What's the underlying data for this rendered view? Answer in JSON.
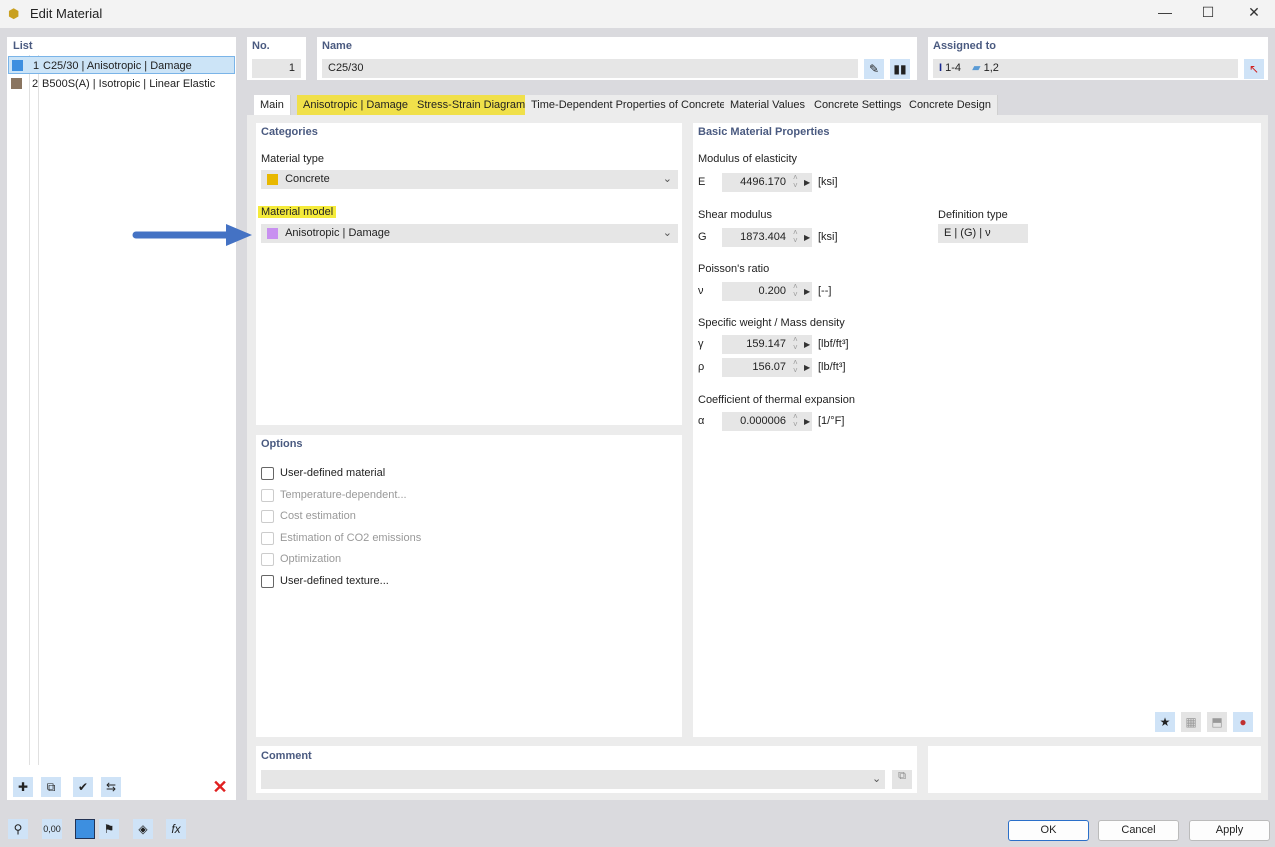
{
  "window": {
    "title": "Edit Material"
  },
  "list": {
    "header": "List",
    "items": [
      {
        "no": "1",
        "label": "C25/30 | Anisotropic | Damage",
        "color": "#3d8fe0",
        "selected": true
      },
      {
        "no": "2",
        "label": "B500S(A) | Isotropic | Linear Elastic",
        "color": "#8a7560",
        "selected": false
      }
    ]
  },
  "no": {
    "label": "No.",
    "value": "1"
  },
  "name": {
    "label": "Name",
    "value": "C25/30"
  },
  "assigned": {
    "label": "Assigned to",
    "members": "1-4",
    "surfaces": "1,2"
  },
  "tabs": [
    {
      "label": "Main"
    },
    {
      "label": "Anisotropic | Damage"
    },
    {
      "label": "Stress-Strain Diagram"
    },
    {
      "label": "Time-Dependent Properties of Concrete"
    },
    {
      "label": "Material Values"
    },
    {
      "label": "Concrete Settings"
    },
    {
      "label": "Concrete Design"
    }
  ],
  "categories": {
    "header": "Categories",
    "material_type_label": "Material type",
    "material_type": "Concrete",
    "material_type_color": "#e8b800",
    "material_model_label": "Material model",
    "material_model": "Anisotropic | Damage",
    "material_model_color": "#c890f0"
  },
  "options": {
    "header": "Options",
    "items": [
      {
        "label": "User-defined material",
        "enabled": true
      },
      {
        "label": "Temperature-dependent...",
        "enabled": false
      },
      {
        "label": "Cost estimation",
        "enabled": false
      },
      {
        "label": "Estimation of CO2 emissions",
        "enabled": false
      },
      {
        "label": "Optimization",
        "enabled": false
      },
      {
        "label": "User-defined texture...",
        "enabled": true
      }
    ]
  },
  "props": {
    "header": "Basic Material Properties",
    "modulus_label": "Modulus of elasticity",
    "E": {
      "sym": "E",
      "value": "4496.170",
      "unit": "[ksi]"
    },
    "shear_label": "Shear modulus",
    "G": {
      "sym": "G",
      "value": "1873.404",
      "unit": "[ksi]"
    },
    "deftype_label": "Definition type",
    "deftype": "E | (G) | ν",
    "poisson_label": "Poisson's ratio",
    "nu": {
      "sym": "ν",
      "value": "0.200",
      "unit": "[--]"
    },
    "weight_label": "Specific weight / Mass density",
    "gamma": {
      "sym": "γ",
      "value": "159.147",
      "unit": "[lbf/ft³]"
    },
    "rho": {
      "sym": "ρ",
      "value": "156.07",
      "unit": "[lb/ft³]"
    },
    "thermal_label": "Coefficient of thermal expansion",
    "alpha": {
      "sym": "α",
      "value": "0.000006",
      "unit": "[1/°F]"
    }
  },
  "comment": {
    "label": "Comment",
    "value": ""
  },
  "footer": {
    "ok": "OK",
    "cancel": "Cancel",
    "apply": "Apply"
  }
}
